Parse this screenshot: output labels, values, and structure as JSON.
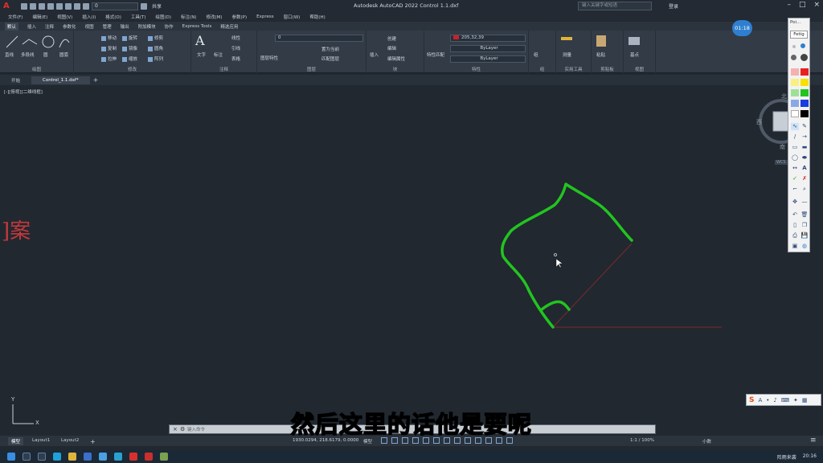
{
  "titlebar": {
    "app_letter": "A",
    "layer_combo": "0",
    "share_label": "共享",
    "title": "Autodesk AutoCAD 2022    Control 1.1.dxf",
    "search_placeholder": "键入关键字或短语",
    "login_label": "登录"
  },
  "menu": [
    "文件(F)",
    "编辑(E)",
    "视图(V)",
    "插入(I)",
    "格式(O)",
    "工具(T)",
    "绘图(D)",
    "标注(N)",
    "修改(M)",
    "参数(P)",
    "Express",
    "窗口(W)",
    "帮助(H)"
  ],
  "ribbon_tabs": [
    "默认",
    "插入",
    "注释",
    "参数化",
    "视图",
    "管理",
    "输出",
    "附加模块",
    "协作",
    "Express Tools",
    "精选应用"
  ],
  "ribbon": {
    "draw": {
      "label": "绘图",
      "tools": [
        "直线",
        "多段线",
        "圆",
        "圆弧"
      ]
    },
    "modify": {
      "label": "修改",
      "tools": [
        "移动",
        "旋转",
        "修剪",
        "复制",
        "镜像",
        "圆角",
        "拉伸",
        "缩放",
        "阵列"
      ]
    },
    "annotation": {
      "label": "注释",
      "tools": [
        "文字",
        "标注",
        "线性",
        "引线",
        "表格"
      ]
    },
    "layers": {
      "label": "图层",
      "layer_value": "0",
      "tools": [
        "图层特性",
        "置为当前",
        "匹配图层"
      ]
    },
    "block": {
      "label": "块",
      "tools": [
        "插入",
        "创建",
        "编辑",
        "编辑属性"
      ]
    },
    "properties": {
      "label": "特性",
      "color_value": "205,32,39",
      "linetype_value": "ByLayer",
      "lineweight_value": "ByLayer",
      "tools": [
        "特性匹配"
      ]
    },
    "groups": {
      "label": "组",
      "tools": [
        "组"
      ]
    },
    "utilities": {
      "label": "实用工具",
      "tools": [
        "测量"
      ]
    },
    "clipboard": {
      "label": "剪贴板",
      "tools": [
        "粘贴"
      ]
    },
    "view": {
      "label": "视图",
      "tools": [
        "基点"
      ]
    }
  },
  "doc_tabs": [
    "开始",
    "Control_1.1.dxf*"
  ],
  "canvas": {
    "view_label": "[-][俯视][二维线框]",
    "side_text": "]案",
    "viewcube": {
      "north": "北",
      "west": "西",
      "south": "南",
      "east": "东",
      "wcs": "WCS"
    },
    "axis_y": "Y",
    "axis_x": "X"
  },
  "command_placeholder": "键入命令",
  "subtitle": "然后这里的话他是要呢",
  "status": {
    "tabs": [
      "模型",
      "Layout1",
      "Layout2"
    ],
    "coordinates": "1930.0294, 218.6179, 0.0000",
    "model_label": "模型",
    "scale": "1:1 / 100%",
    "decimal": "小数"
  },
  "timer": "01:18",
  "palette": {
    "title": "Poi...",
    "button": "Fetig"
  },
  "taskbar": {
    "right_text": "阵雨来袭",
    "time": "20:16"
  },
  "colors": {
    "drawing_green": "#22c41f",
    "guide_red": "#7a2a2e",
    "accent_blue": "#2f7fd0"
  }
}
